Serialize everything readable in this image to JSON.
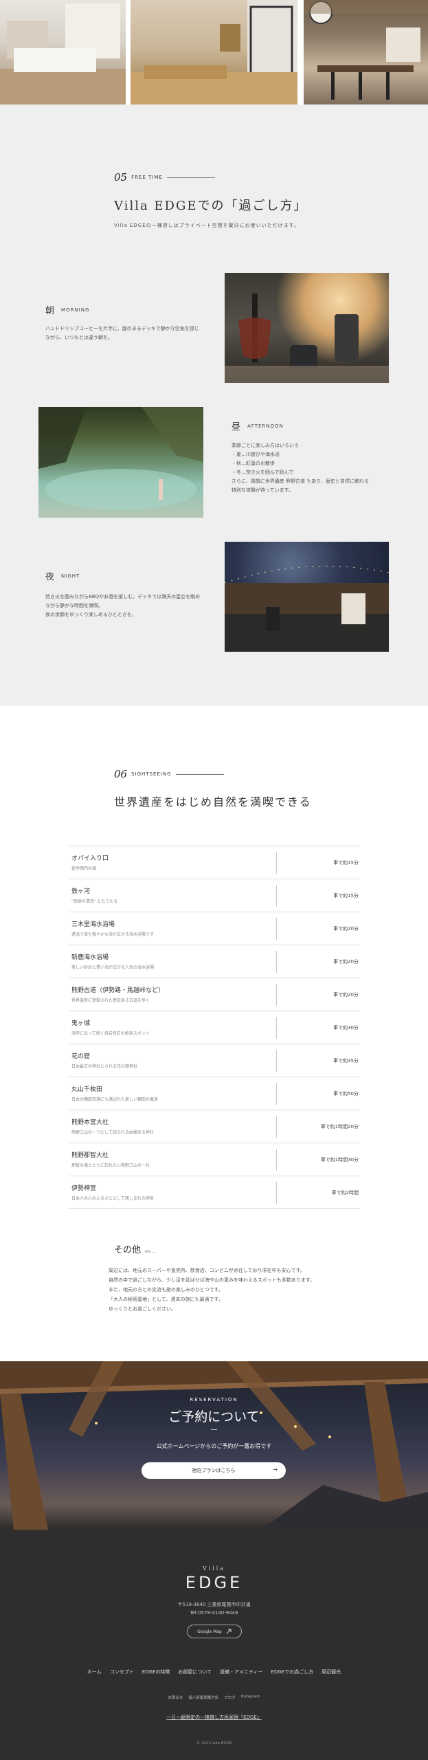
{
  "free_time": {
    "num": "05",
    "label": "FREE TIME",
    "title": "Villa EDGEでの「過ごし方」",
    "subtitle": "Villa EDGEの一棟貸しはプライベート空間を贅沢にお使いいただけます。",
    "morning": {
      "kanji": "朝",
      "en": "MORNING",
      "body": "ハンドドリップコーヒーを片手に、庭のまるデッキで静かな空気を感じながら、いつもとは違う朝を。"
    },
    "afternoon": {
      "kanji": "昼",
      "en": "AFTERNOON",
      "lines": [
        "季節ごとに楽しみ方はいろいろ",
        "・夏…川遊びや海水浴",
        "・秋…紅葉のお散歩",
        "・冬…焚き火を囲んで読んで",
        "さらに、風韻に世界遺産 熊野古道 もあり、歴史と自然に触れる",
        "特別な体験が待っています。"
      ]
    },
    "night": {
      "kanji": "夜",
      "en": "NIGHT",
      "body": "焚き火を囲みながらBBQやお酒を楽しむ。デッキでは満天の星空を眺めながら静かな時間を満喫。",
      "body2": "夜の余韻をゆっくり楽しめるひとときを。"
    }
  },
  "sightseeing": {
    "num": "06",
    "label": "SIGHTSEEING",
    "title": "世界遺産をはじめ自然を満喫できる",
    "rows": [
      {
        "name": "オバイ入り口",
        "desc": "徒歩圏内の滝",
        "time": "車で約15分"
      },
      {
        "name": "鉄ヶ河",
        "desc": "\"奇跡の清流\" ともうたる",
        "time": "車で約15分"
      },
      {
        "name": "三木里海水浴場",
        "desc": "遠浅で波も穏やかな海が広がる海水浴場です",
        "time": "車で約20分"
      },
      {
        "name": "新鹿海水浴場",
        "desc": "美しい砂浜と青い海が広がる人気の海水浴場",
        "time": "車で約20分"
      },
      {
        "name": "熊野古道（伊勢路・馬越峠など）",
        "desc": "世界遺産に登録された歴史ある古道を歩く",
        "time": "車で約20分"
      },
      {
        "name": "鬼ヶ城",
        "desc": "海岸に沿って続く奇岩怪石の絶景スポット",
        "time": "車で約30分"
      },
      {
        "name": "花の窟",
        "desc": "日本最古の神社とされる花の窟神社",
        "time": "車で約35分"
      },
      {
        "name": "丸山千枚田",
        "desc": "日本の棚田百選にも選ばれた美しい棚田の風景",
        "time": "車で約50分"
      },
      {
        "name": "熊野本宮大社",
        "desc": "熊野三山の一つとして知られる由緒ある神社",
        "time": "車で約1時間20分"
      },
      {
        "name": "熊野那智大社",
        "desc": "那智の滝とともに訪れたい熊野三山の一社",
        "time": "車で約1時間30分"
      },
      {
        "name": "伊勢神宮",
        "desc": "日本人の心のふるさととして親しまれる神宮",
        "time": "車で約2時間"
      }
    ],
    "other_title": "その他",
    "other_en": "etc...",
    "other_lines": [
      "周辺には、地元のスーパーや直売所、飲食店、コンビニが点在しており滞在中も安心です。",
      "自然の中で過ごしながら、少し足を延ばせば海や山の恵みを味わえるスポットも多数あります。",
      "また、地元の方との交流も旅の楽しみのひとつです。",
      "「大人の秘密基地」として、週末の旅にも最適です。",
      "ゆっくりとお過ごしください。"
    ]
  },
  "reservation": {
    "en": "RESERVATION",
    "title": "ご予約について",
    "sub": "公式ホームページからのご予約が一番お得です",
    "button": "宿泊プランはこちら",
    "arrow": "→"
  },
  "footer": {
    "logo_small": "Villa",
    "logo": "EDGE",
    "address1": "〒519-3640",
    "address2": "三重県尾鷲市中井浦",
    "tel": "Tel:0578-4140-9446",
    "map_button": "Google Map",
    "nav": [
      "ホーム",
      "コンセプト",
      "EDGEの特徴",
      "お部屋について",
      "設備・アメニティー",
      "EDGEでの過ごし方",
      "周辺観光"
    ],
    "sub_links": [
      "お問合せ",
      "個人情報保護方針",
      "ブログ",
      "Instagram"
    ],
    "tagline": "一日一組限定の一棟貸し古民家宿『EDGE』",
    "copyright": "© 2023 villa EDGE"
  },
  "icons": {
    "arrow": "arrow-right-icon",
    "map": "external-link-icon"
  }
}
